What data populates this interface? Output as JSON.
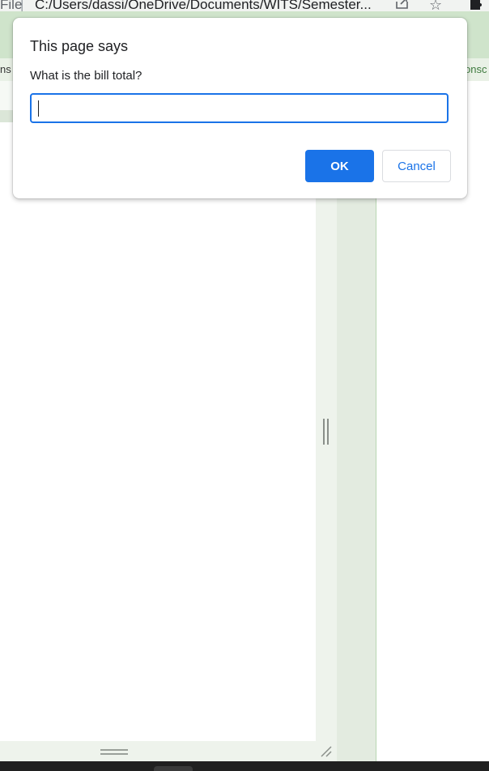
{
  "browser": {
    "scheme_label": "File",
    "url": "C:/Users/dassi/OneDrive/Documents/WITS/Semester..."
  },
  "devtools": {
    "left_tab": "ns",
    "right_tab": "onsc"
  },
  "dialog": {
    "title": "This page says",
    "message": "What is the bill total?",
    "input_value": "",
    "ok_label": "OK",
    "cancel_label": "Cancel"
  },
  "colors": {
    "accent": "#1a73e8",
    "devtools_green": "#cfe4cb"
  }
}
